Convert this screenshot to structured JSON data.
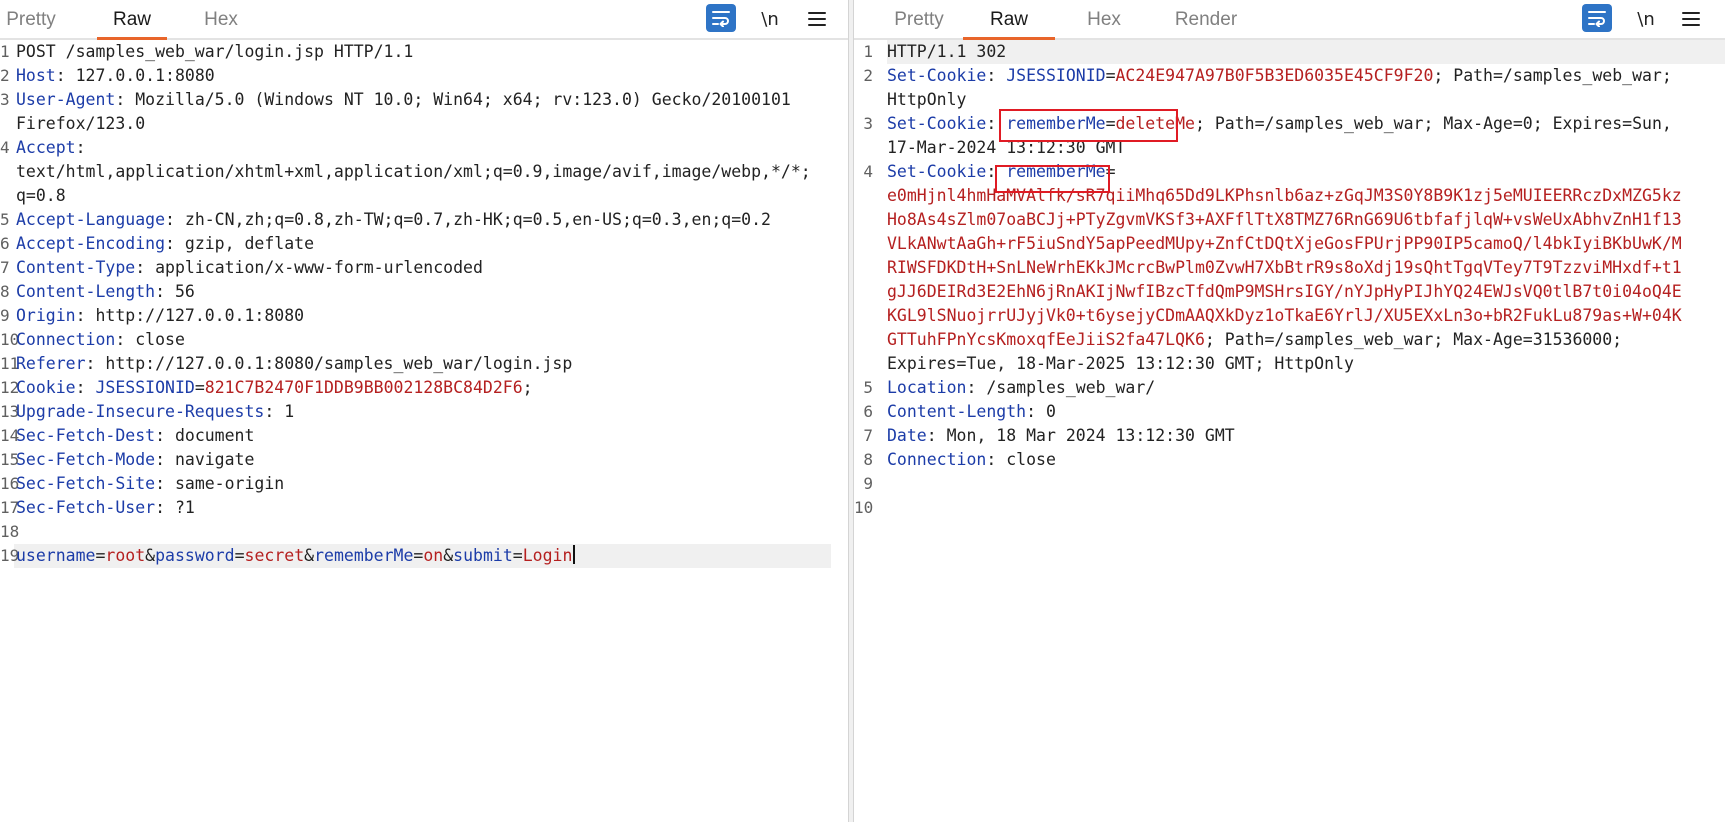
{
  "request": {
    "tabs": [
      {
        "label": "Pretty",
        "active": false
      },
      {
        "label": "Raw",
        "active": true
      },
      {
        "label": "Hex",
        "active": false
      }
    ],
    "toolbar": {
      "newline_label": "\\n"
    },
    "lines": [
      {
        "n": "1",
        "segs": [
          {
            "t": "POST /samples_web_war/login.jsp HTTP/1.1",
            "c": "v"
          }
        ]
      },
      {
        "n": "2",
        "segs": [
          {
            "t": "Host",
            "c": "k"
          },
          {
            "t": ": 127.0.0.1:8080",
            "c": "v"
          }
        ]
      },
      {
        "n": "3",
        "segs": [
          {
            "t": "User-Agent",
            "c": "k"
          },
          {
            "t": ": Mozilla/5.0 (Windows NT 10.0; Win64; x64; rv:123.0) Gecko/20100101",
            "c": "v"
          }
        ]
      },
      {
        "n": "",
        "segs": [
          {
            "t": "Firefox/123.0",
            "c": "v"
          }
        ]
      },
      {
        "n": "4",
        "segs": [
          {
            "t": "Accept",
            "c": "k"
          },
          {
            "t": ":",
            "c": "v"
          }
        ]
      },
      {
        "n": "",
        "segs": [
          {
            "t": "text/html,application/xhtml+xml,application/xml;q=0.9,image/avif,image/webp,*/*;",
            "c": "v"
          }
        ]
      },
      {
        "n": "",
        "segs": [
          {
            "t": "q=0.8",
            "c": "v"
          }
        ]
      },
      {
        "n": "5",
        "segs": [
          {
            "t": "Accept-Language",
            "c": "k"
          },
          {
            "t": ": zh-CN,zh;q=0.8,zh-TW;q=0.7,zh-HK;q=0.5,en-US;q=0.3,en;q=0.2",
            "c": "v"
          }
        ]
      },
      {
        "n": "6",
        "segs": [
          {
            "t": "Accept-Encoding",
            "c": "k"
          },
          {
            "t": ": gzip, deflate",
            "c": "v"
          }
        ]
      },
      {
        "n": "7",
        "segs": [
          {
            "t": "Content-Type",
            "c": "k"
          },
          {
            "t": ": application/x-www-form-urlencoded",
            "c": "v"
          }
        ]
      },
      {
        "n": "8",
        "segs": [
          {
            "t": "Content-Length",
            "c": "k"
          },
          {
            "t": ": 56",
            "c": "v"
          }
        ]
      },
      {
        "n": "9",
        "segs": [
          {
            "t": "Origin",
            "c": "k"
          },
          {
            "t": ": http://127.0.0.1:8080",
            "c": "v"
          }
        ]
      },
      {
        "n": "10",
        "segs": [
          {
            "t": "Connection",
            "c": "k"
          },
          {
            "t": ": close",
            "c": "v"
          }
        ]
      },
      {
        "n": "11",
        "segs": [
          {
            "t": "Referer",
            "c": "k"
          },
          {
            "t": ": http://127.0.0.1:8080/samples_web_war/login.jsp",
            "c": "v"
          }
        ]
      },
      {
        "n": "12",
        "segs": [
          {
            "t": "Cookie",
            "c": "k"
          },
          {
            "t": ": ",
            "c": "v"
          },
          {
            "t": "JSESSIONID",
            "c": "k"
          },
          {
            "t": "=",
            "c": "v"
          },
          {
            "t": "821C7B2470F1DDB9BB002128BC84D2F6",
            "c": "r"
          },
          {
            "t": ";",
            "c": "v"
          }
        ]
      },
      {
        "n": "13",
        "segs": [
          {
            "t": "Upgrade-Insecure-Requests",
            "c": "k"
          },
          {
            "t": ": 1",
            "c": "v"
          }
        ]
      },
      {
        "n": "14",
        "segs": [
          {
            "t": "Sec-Fetch-Dest",
            "c": "k"
          },
          {
            "t": ": document",
            "c": "v"
          }
        ]
      },
      {
        "n": "15",
        "segs": [
          {
            "t": "Sec-Fetch-Mode",
            "c": "k"
          },
          {
            "t": ": navigate",
            "c": "v"
          }
        ]
      },
      {
        "n": "16",
        "segs": [
          {
            "t": "Sec-Fetch-Site",
            "c": "k"
          },
          {
            "t": ": same-origin",
            "c": "v"
          }
        ]
      },
      {
        "n": "17",
        "segs": [
          {
            "t": "Sec-Fetch-User",
            "c": "k"
          },
          {
            "t": ": ?1",
            "c": "v"
          }
        ]
      },
      {
        "n": "18",
        "segs": []
      },
      {
        "n": "19",
        "highlight": true,
        "caret": true,
        "segs": [
          {
            "t": "username",
            "c": "k"
          },
          {
            "t": "=",
            "c": "v"
          },
          {
            "t": "root",
            "c": "r"
          },
          {
            "t": "&",
            "c": "v"
          },
          {
            "t": "password",
            "c": "k"
          },
          {
            "t": "=",
            "c": "v"
          },
          {
            "t": "secret",
            "c": "r"
          },
          {
            "t": "&",
            "c": "v"
          },
          {
            "t": "rememberMe",
            "c": "k"
          },
          {
            "t": "=",
            "c": "v"
          },
          {
            "t": "on",
            "c": "r"
          },
          {
            "t": "&",
            "c": "v"
          },
          {
            "t": "submit",
            "c": "k"
          },
          {
            "t": "=",
            "c": "v"
          },
          {
            "t": "Login",
            "c": "r"
          }
        ]
      }
    ]
  },
  "response": {
    "tabs": [
      {
        "label": "Pretty",
        "active": false
      },
      {
        "label": "Raw",
        "active": true
      },
      {
        "label": "Hex",
        "active": false
      },
      {
        "label": "Render",
        "active": false
      }
    ],
    "toolbar": {
      "newline_label": "\\n"
    },
    "lines": [
      {
        "n": "1",
        "highlight": true,
        "segs": [
          {
            "t": "HTTP/1.1 302",
            "c": "v"
          }
        ]
      },
      {
        "n": "2",
        "segs": [
          {
            "t": "Set-Cookie",
            "c": "k"
          },
          {
            "t": ": ",
            "c": "v"
          },
          {
            "t": "JSESSIONID",
            "c": "k"
          },
          {
            "t": "=",
            "c": "v"
          },
          {
            "t": "AC24E947A97B0F5B3ED6035E45CF9F20",
            "c": "r"
          },
          {
            "t": "; Path=/samples_web_war;",
            "c": "v"
          }
        ]
      },
      {
        "n": "",
        "segs": [
          {
            "t": "HttpOnly",
            "c": "v"
          }
        ]
      },
      {
        "n": "3",
        "segs": [
          {
            "t": "Set-Cookie",
            "c": "k"
          },
          {
            "t": ": ",
            "c": "v"
          },
          {
            "t": "rememberMe",
            "c": "k"
          },
          {
            "t": "=",
            "c": "v"
          },
          {
            "t": "deleteMe",
            "c": "r"
          },
          {
            "t": "; Path=/samples_web_war; Max-Age=0; Expires=Sun,",
            "c": "v"
          }
        ]
      },
      {
        "n": "",
        "segs": [
          {
            "t": "17-Mar-2024 13:12:30 GMT",
            "c": "v"
          }
        ]
      },
      {
        "n": "4",
        "segs": [
          {
            "t": "Set-Cookie",
            "c": "k"
          },
          {
            "t": ": ",
            "c": "v"
          },
          {
            "t": "rememberMe",
            "c": "k"
          },
          {
            "t": "=",
            "c": "v"
          }
        ]
      },
      {
        "n": "",
        "segs": [
          {
            "t": "e0mHjnl4hmHaMVAlfk/sR7qiiMhq65Dd9LKPhsnlb6az+zGqJM3S0Y8B9K1zj5eMUIEERRczDxMZG5kz",
            "c": "r"
          }
        ]
      },
      {
        "n": "",
        "segs": [
          {
            "t": "Ho8As4sZlm07oaBCJj+PTyZgvmVKSf3+AXFflTtX8TMZ76RnG69U6tbfafjlqW+vsWeUxAbhvZnH1f13",
            "c": "r"
          }
        ]
      },
      {
        "n": "",
        "segs": [
          {
            "t": "VLkANwtAaGh+rF5iuSndY5apPeedMUpy+ZnfCtDQtXjeGosFPUrjPP90IP5camoQ/l4bkIyiBKbUwK/M",
            "c": "r"
          }
        ]
      },
      {
        "n": "",
        "segs": [
          {
            "t": "RIWSFDKDtH+SnLNeWrhEKkJMcrcBwPlm0ZvwH7XbBtrR9s8oXdj19sQhtTgqVTey7T9TzzviMHxdf+t1",
            "c": "r"
          }
        ]
      },
      {
        "n": "",
        "segs": [
          {
            "t": "gJJ6DEIRd3E2EhN6jRnAKIjNwfIBzcTfdQmP9MSHrsIGY/nYJpHyPIJhYQ24EWJsVQ0tlB7t0i04oQ4E",
            "c": "r"
          }
        ]
      },
      {
        "n": "",
        "segs": [
          {
            "t": "KGL9lSNuojrrUJyjVk0+t6ysejyCDmAAQXkDyz1oTkaE6YrlJ/XU5EXxLn3o+bR2FukLu879as+W+04K",
            "c": "r"
          }
        ]
      },
      {
        "n": "",
        "segs": [
          {
            "t": "GTTuhFPnYcsKmoxqfEeJiiS2fa47LQK6",
            "c": "r"
          },
          {
            "t": "; Path=/samples_web_war; Max-Age=31536000;",
            "c": "v"
          }
        ]
      },
      {
        "n": "",
        "segs": [
          {
            "t": "Expires=Tue, 18-Mar-2025 13:12:30 GMT; HttpOnly",
            "c": "v"
          }
        ]
      },
      {
        "n": "5",
        "segs": [
          {
            "t": "Location",
            "c": "k"
          },
          {
            "t": ": /samples_web_war/",
            "c": "v"
          }
        ]
      },
      {
        "n": "6",
        "segs": [
          {
            "t": "Content-Length",
            "c": "k"
          },
          {
            "t": ": 0",
            "c": "v"
          }
        ]
      },
      {
        "n": "7",
        "segs": [
          {
            "t": "Date",
            "c": "k"
          },
          {
            "t": ": Mon, 18 Mar 2024 13:12:30 GMT",
            "c": "v"
          }
        ]
      },
      {
        "n": "8",
        "segs": [
          {
            "t": "Connection",
            "c": "k"
          },
          {
            "t": ": close",
            "c": "v"
          }
        ]
      },
      {
        "n": "9",
        "segs": []
      },
      {
        "n": "10",
        "segs": []
      }
    ]
  },
  "colors": {
    "header_name": "#1c3ca8",
    "value_red": "#b52020",
    "active_tab_underline": "#e8652a",
    "wrap_button": "#2e74c6",
    "annotation_box": "#e01b24"
  },
  "icons": {
    "wrap": "word-wrap-icon",
    "newline": "show-newlines-icon",
    "menu": "hamburger-menu-icon"
  }
}
